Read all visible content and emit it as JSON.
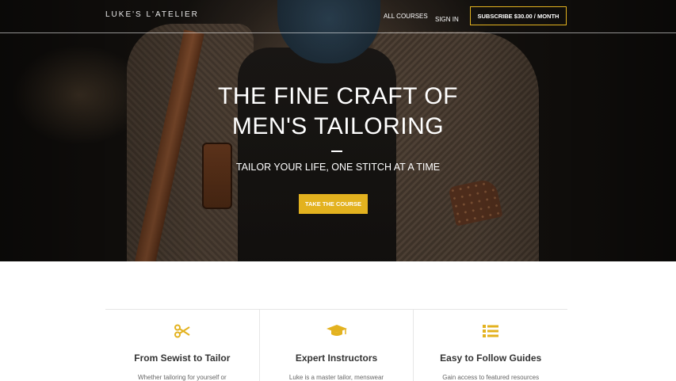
{
  "brand": "LUKE'S L'ATELIER",
  "nav": {
    "all_courses": "ALL COURSES",
    "sign_in": "SIGN IN",
    "subscribe": "SUBSCRIBE $30.00 / MONTH"
  },
  "hero": {
    "title_line1": "THE FINE CRAFT OF",
    "title_line2": "MEN'S TAILORING",
    "tagline": "TAILOR YOUR LIFE, ONE STITCH AT A TIME",
    "cta": "TAKE THE COURSE"
  },
  "colors": {
    "accent": "#e3b21f",
    "text_dark": "#333333"
  },
  "features": [
    {
      "icon": "scissors-icon",
      "title": "From Sewist to Tailor",
      "desc": "Whether tailoring for yourself or"
    },
    {
      "icon": "graduation-cap-icon",
      "title": "Expert Instructors",
      "desc": "Luke is a master tailor, menswear"
    },
    {
      "icon": "list-icon",
      "title": "Easy to Follow Guides",
      "desc": "Gain access to featured resources"
    }
  ]
}
